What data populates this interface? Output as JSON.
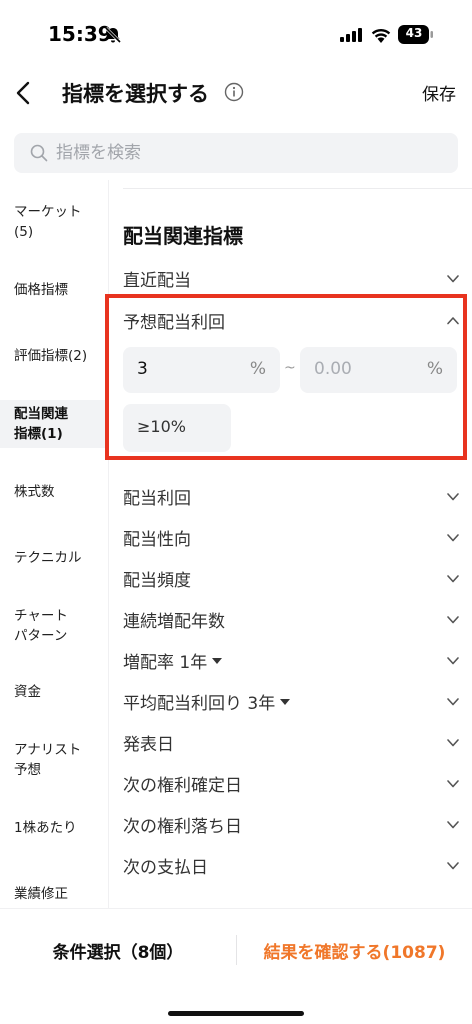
{
  "status_bar": {
    "time": "15:39",
    "battery": "43"
  },
  "header": {
    "title": "指標を選択する",
    "save_label": "保存"
  },
  "search": {
    "placeholder": "指標を検索"
  },
  "sidebar": {
    "items": [
      {
        "label": "マーケット\n(5)",
        "active": false
      },
      {
        "label": "価格指標",
        "active": false
      },
      {
        "label": "評価指標(2)",
        "active": false
      },
      {
        "label": "配当関連\n指標(1)",
        "active": true
      },
      {
        "label": "株式数",
        "active": false
      },
      {
        "label": "テクニカル",
        "active": false
      },
      {
        "label": "チャート\nパターン",
        "active": false
      },
      {
        "label": "資金",
        "active": false
      },
      {
        "label": "アナリスト\n予想",
        "active": false
      },
      {
        "label": "1株あたり",
        "active": false
      },
      {
        "label": "業績修正",
        "active": false
      }
    ]
  },
  "main": {
    "section_title": "配当関連指標",
    "rows": [
      {
        "label": "直近配当",
        "expanded": false
      },
      {
        "label": "予想配当利回",
        "expanded": true
      },
      {
        "label": "配当利回",
        "expanded": false
      },
      {
        "label": "配当性向",
        "expanded": false
      },
      {
        "label": "配当頻度",
        "expanded": false
      },
      {
        "label": "連続増配年数",
        "expanded": false
      },
      {
        "label": "増配率",
        "option": "1年",
        "expanded": false
      },
      {
        "label": "平均配当利回り",
        "option": "3年",
        "expanded": false
      },
      {
        "label": "発表日",
        "expanded": false
      },
      {
        "label": "次の権利確定日",
        "expanded": false
      },
      {
        "label": "次の権利落ち日",
        "expanded": false
      },
      {
        "label": "次の支払日",
        "expanded": false
      }
    ],
    "range": {
      "min_value": "3",
      "max_placeholder": "0.00",
      "unit": "%",
      "separator": "~",
      "preset": "≥10%"
    }
  },
  "bottom": {
    "conditions_label": "条件選択（8個）",
    "results_label": "結果を確認する(1087)"
  },
  "colors": {
    "accent": "#f0772a",
    "highlight": "#e8331f",
    "chip_bg": "#f2f3f5"
  }
}
